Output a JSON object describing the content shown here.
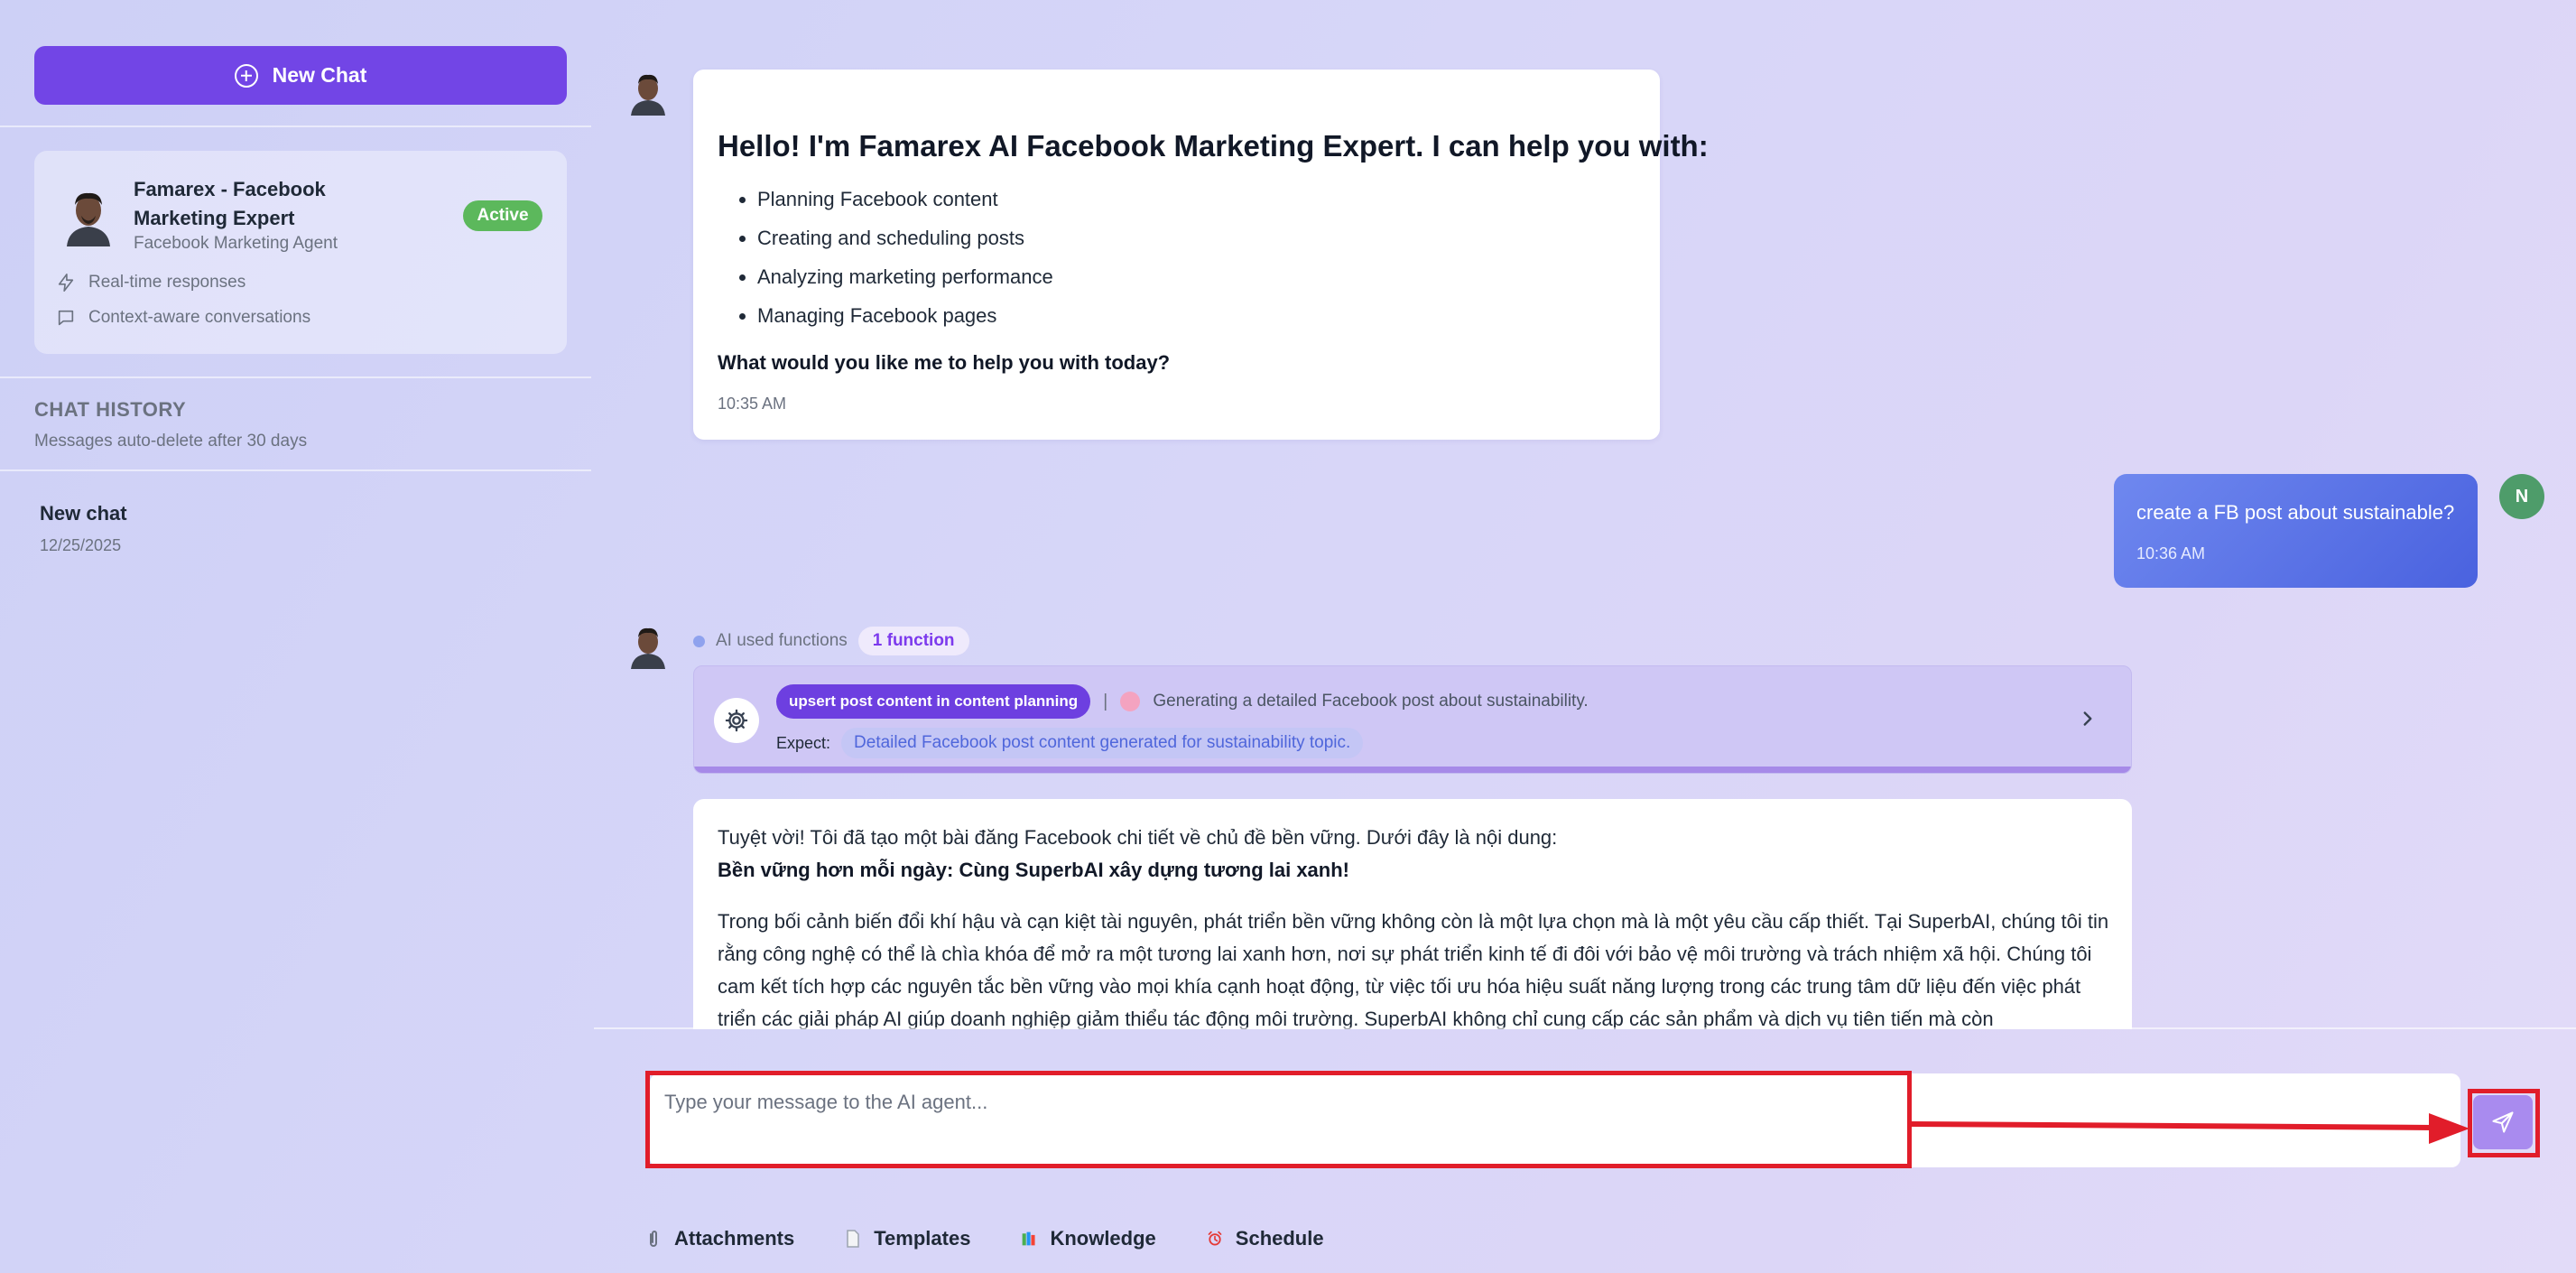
{
  "sidebar": {
    "new_chat_label": "New Chat",
    "agent": {
      "name": "Famarex - Facebook Marketing Expert",
      "subtitle": "Facebook Marketing Agent",
      "status": "Active",
      "features": [
        "Real-time responses",
        "Context-aware conversations"
      ]
    },
    "history": {
      "title": "CHAT HISTORY",
      "note": "Messages auto-delete after 30 days",
      "items": [
        {
          "title": "New chat",
          "date": "12/25/2025"
        }
      ]
    }
  },
  "chat": {
    "greeting": {
      "title": "Hello! I'm Famarex AI Facebook Marketing Expert. I can help you with:",
      "items": [
        "Planning Facebook content",
        "Creating and scheduling posts",
        "Analyzing marketing performance",
        "Managing Facebook pages"
      ],
      "question": "What would you like me to help you with today?",
      "time": "10:35 AM"
    },
    "user_message": {
      "text": "create a FB post about sustainable?",
      "time": "10:36 AM",
      "avatar_initial": "N"
    },
    "function_call": {
      "label": "AI used functions",
      "count": "1 function",
      "name": "upsert post content in content planning",
      "separator": "|",
      "description": "Generating a detailed Facebook post about sustainability.",
      "expect_label": "Expect:",
      "expect_value": "Detailed Facebook post content generated for sustainability topic."
    },
    "response": {
      "line1": "Tuyệt vời! Tôi đã tạo một bài đăng Facebook chi tiết về chủ đề bền vững. Dưới đây là nội dung:",
      "line2": "Bền vững hơn mỗi ngày: Cùng SuperbAI xây dựng tương lai xanh!",
      "paragraph": "Trong bối cảnh biến đổi khí hậu và cạn kiệt tài nguyên, phát triển bền vững không còn là một lựa chọn mà là một yêu cầu cấp thiết. Tại SuperbAI, chúng tôi tin rằng công nghệ có thể là chìa khóa để mở ra một tương lai xanh hơn, nơi sự phát triển kinh tế đi đôi với bảo vệ môi trường và trách nhiệm xã hội. Chúng tôi cam kết tích hợp các nguyên tắc bền vững vào mọi khía cạnh hoạt động, từ việc tối ưu hóa hiệu suất năng lượng trong các trung tâm dữ liệu đến việc phát triển các giải pháp AI giúp doanh nghiệp giảm thiểu tác động môi trường. SuperbAI không chỉ cung cấp các sản phẩm và dịch vụ tiên tiến mà còn"
    }
  },
  "input": {
    "placeholder": "Type your message to the AI agent..."
  },
  "toolbar": {
    "attachments": "Attachments",
    "templates": "Templates",
    "knowledge": "Knowledge",
    "schedule": "Schedule"
  },
  "colors": {
    "accent": "#7245e6",
    "active": "#5cb85c",
    "user_bubble": "#5a74e6",
    "highlight": "#e11d2a"
  }
}
